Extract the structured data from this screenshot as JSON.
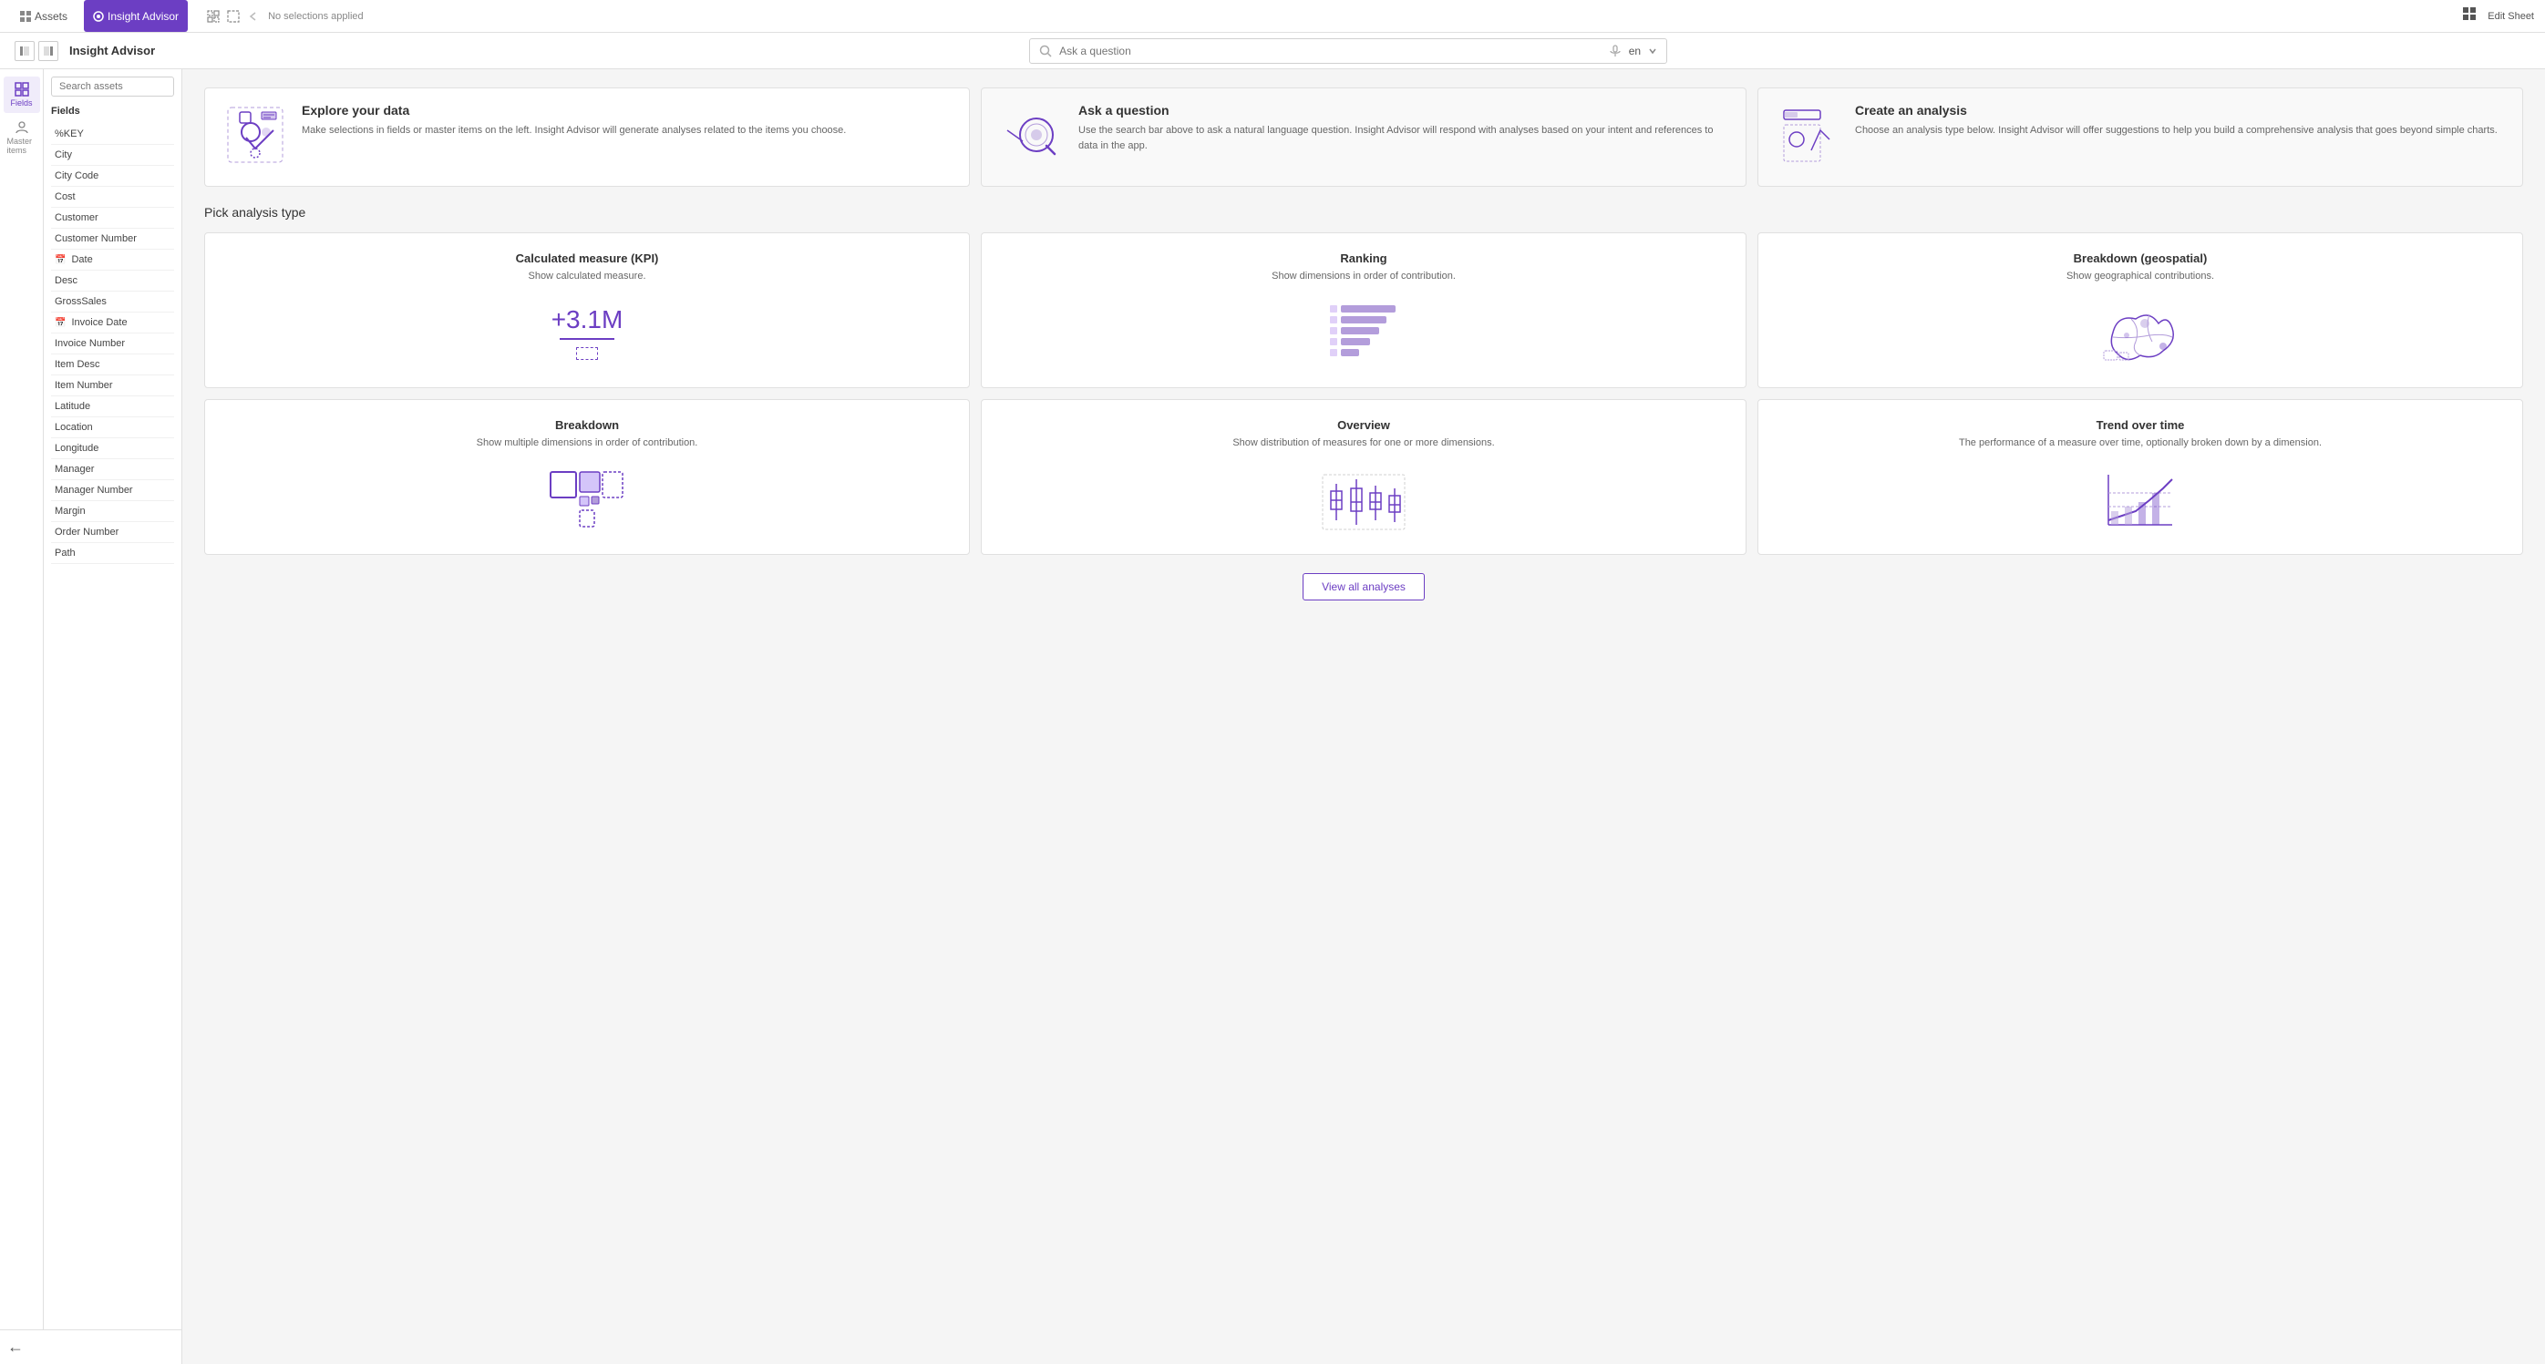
{
  "topNav": {
    "assets_label": "Assets",
    "active_label": "Insight Advisor",
    "no_selections": "No selections applied",
    "edit_sheet": "Edit Sheet",
    "lang": "en"
  },
  "secondBar": {
    "title": "Insight Advisor",
    "search_placeholder": "Ask a question"
  },
  "sidebar": {
    "search_placeholder": "Search assets",
    "fields_title": "Fields",
    "items": [
      {
        "label": "%KEY",
        "icon": ""
      },
      {
        "label": "City",
        "icon": ""
      },
      {
        "label": "City Code",
        "icon": ""
      },
      {
        "label": "Cost",
        "icon": ""
      },
      {
        "label": "Customer",
        "icon": ""
      },
      {
        "label": "Customer Number",
        "icon": ""
      },
      {
        "label": "Date",
        "icon": "cal"
      },
      {
        "label": "Desc",
        "icon": ""
      },
      {
        "label": "GrossSales",
        "icon": ""
      },
      {
        "label": "Invoice Date",
        "icon": "cal"
      },
      {
        "label": "Invoice Number",
        "icon": ""
      },
      {
        "label": "Item Desc",
        "icon": ""
      },
      {
        "label": "Item Number",
        "icon": ""
      },
      {
        "label": "Latitude",
        "icon": ""
      },
      {
        "label": "Location",
        "icon": ""
      },
      {
        "label": "Longitude",
        "icon": ""
      },
      {
        "label": "Manager",
        "icon": ""
      },
      {
        "label": "Manager Number",
        "icon": ""
      },
      {
        "label": "Margin",
        "icon": ""
      },
      {
        "label": "Order Number",
        "icon": ""
      },
      {
        "label": "Path",
        "icon": ""
      }
    ],
    "fields_icon_label": "Fields",
    "master_items_label": "Master items"
  },
  "infoCards": [
    {
      "title": "Explore your data",
      "description": "Make selections in fields or master items on the left. Insight Advisor will generate analyses related to the items you choose."
    },
    {
      "title": "Ask a question",
      "description": "Use the search bar above to ask a natural language question. Insight Advisor will respond with analyses based on your intent and references to data in the app."
    },
    {
      "title": "Create an analysis",
      "description": "Choose an analysis type below. Insight Advisor will offer suggestions to help you build a comprehensive analysis that goes beyond simple charts."
    }
  ],
  "pickAnalysis": {
    "title": "Pick analysis type",
    "cards": [
      {
        "title": "Calculated measure (KPI)",
        "description": "Show calculated measure.",
        "visual": "kpi",
        "kpi_value": "+3.1M"
      },
      {
        "title": "Ranking",
        "description": "Show dimensions in order of contribution.",
        "visual": "ranking"
      },
      {
        "title": "Breakdown (geospatial)",
        "description": "Show geographical contributions.",
        "visual": "geo"
      },
      {
        "title": "Breakdown",
        "description": "Show multiple dimensions in order of contribution.",
        "visual": "breakdown"
      },
      {
        "title": "Overview",
        "description": "Show distribution of measures for one or more dimensions.",
        "visual": "overview"
      },
      {
        "title": "Trend over time",
        "description": "The performance of a measure over time, optionally broken down by a dimension.",
        "visual": "trend"
      }
    ],
    "view_all_label": "View all analyses"
  }
}
